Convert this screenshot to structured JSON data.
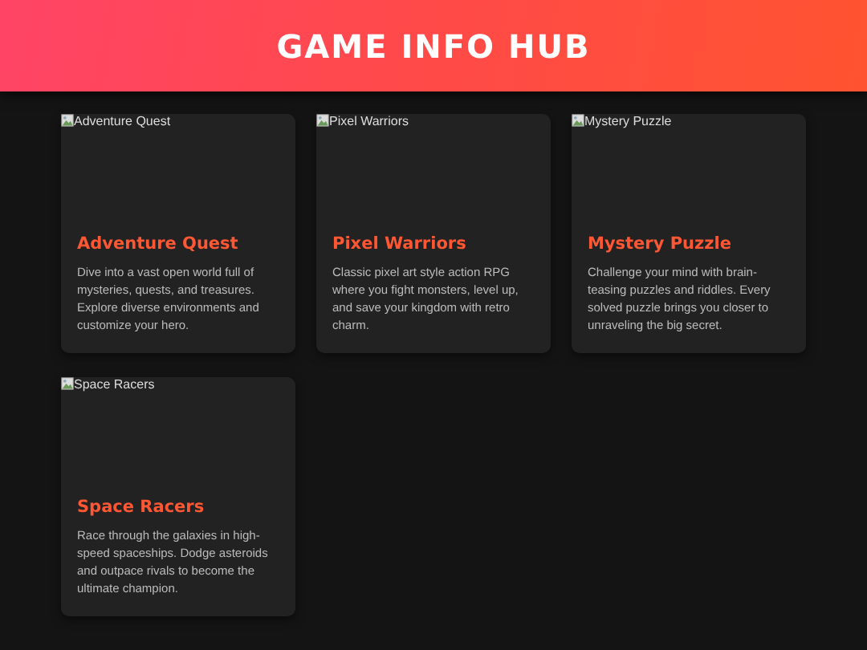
{
  "header": {
    "title": "GAME INFO HUB"
  },
  "games": [
    {
      "image_alt": "Adventure Quest",
      "title": "Adventure Quest",
      "description": "Dive into a vast open world full of mysteries, quests, and treasures. Explore diverse environments and customize your hero."
    },
    {
      "image_alt": "Pixel Warriors",
      "title": "Pixel Warriors",
      "description": "Classic pixel art style action RPG where you fight monsters, level up, and save your kingdom with retro charm."
    },
    {
      "image_alt": "Mystery Puzzle",
      "title": "Mystery Puzzle",
      "description": "Challenge your mind with brain-teasing puzzles and riddles. Every solved puzzle brings you closer to unraveling the big secret."
    },
    {
      "image_alt": "Space Racers",
      "title": "Space Racers",
      "description": "Race through the galaxies in high-speed spaceships. Dodge asteroids and outpace rivals to become the ultimate champion."
    }
  ]
}
